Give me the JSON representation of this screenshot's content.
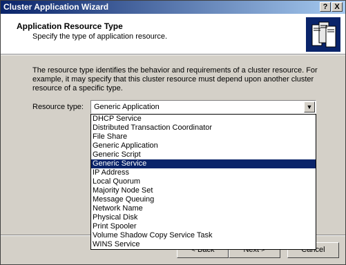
{
  "window": {
    "title": "Cluster Application Wizard",
    "help_label": "?",
    "close_label": "X"
  },
  "header": {
    "title": "Application Resource Type",
    "subtitle": "Specify the type of application resource."
  },
  "description": "The resource type identifies the behavior and requirements of a cluster resource. For example, it may specify that this cluster resource must depend upon another cluster resource of a specific type.",
  "resource_type": {
    "label": "Resource type:",
    "selected_value": "Generic Application",
    "dropdown_arrow": "▼",
    "options": [
      "DHCP Service",
      "Distributed Transaction Coordinator",
      "File Share",
      "Generic Application",
      "Generic Script",
      "Generic Service",
      "IP Address",
      "Local Quorum",
      "Majority Node Set",
      "Message Queuing",
      "Network Name",
      "Physical Disk",
      "Print Spooler",
      "Volume Shadow Copy Service Task",
      "WINS Service"
    ],
    "highlighted_option": "Generic Service"
  },
  "buttons": {
    "back": "< Back",
    "next": "Next >",
    "cancel": "Cancel"
  },
  "colors": {
    "titlebar_start": "#0a246a",
    "titlebar_end": "#a6caf0",
    "selection": "#0a246a",
    "face": "#d4d0c8"
  }
}
